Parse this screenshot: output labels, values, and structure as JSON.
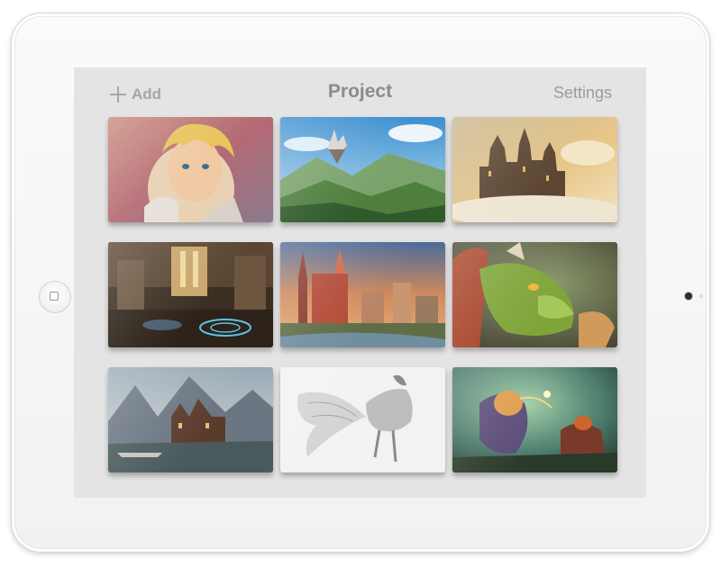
{
  "header": {
    "add_label": "Add",
    "title": "Project",
    "settings_label": "Settings"
  },
  "icons": {
    "add": "plus-icon",
    "home": "home-button-icon"
  },
  "colors": {
    "screen_background": "#e4e4e4",
    "header_text": "#8b8b8b",
    "device_body": "#f4f4f4"
  },
  "gallery": {
    "tiles": [
      "blond-boy-portrait",
      "floating-castle-valley",
      "golden-castle-clouds",
      "library-hall-interior",
      "sunset-city-towers",
      "green-dragon-portrait",
      "harbor-town-mountains",
      "pegasus-sketch",
      "forest-creatures-scene"
    ]
  }
}
